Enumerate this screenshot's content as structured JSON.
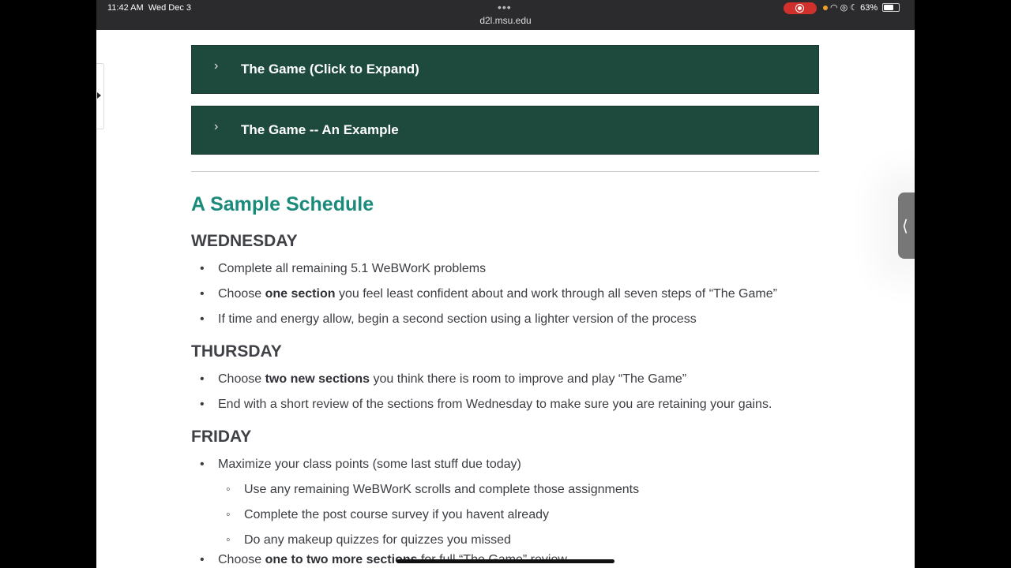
{
  "status": {
    "time": "11:42 AM",
    "date": "Wed Dec 3",
    "url": "d2l.msu.edu",
    "battery": "63%"
  },
  "accordions": [
    {
      "label": "The Game (Click to Expand)"
    },
    {
      "label": "The Game -- An Example"
    }
  ],
  "schedule": {
    "title": "A Sample Schedule",
    "wednesday": {
      "heading": "WEDNESDAY",
      "items": [
        {
          "text": "Complete all remaining 5.1 WeBWorK problems"
        },
        {
          "pre": "Choose ",
          "bold": "one section",
          "post": " you feel least confident about and work through all seven steps of “The Game”"
        },
        {
          "text": "If time and energy allow, begin a second section using a lighter version of the process"
        }
      ]
    },
    "thursday": {
      "heading": "THURSDAY",
      "items": [
        {
          "pre": "Choose ",
          "bold": "two new sections",
          "post": " you think there is room to improve and play “The Game”"
        },
        {
          "text": "End with a short review of the sections from Wednesday to make sure you are retaining your gains."
        }
      ]
    },
    "friday": {
      "heading": "FRIDAY",
      "items": [
        {
          "text": "Maximize your class points (some last stuff due today)"
        },
        {
          "text": "Use any remaining WeBWorK scrolls and complete those assignments"
        },
        {
          "text": "Complete the post course survey if you havent already"
        },
        {
          "text": "Do any makeup quizzes for quizzes you missed"
        },
        {
          "pre": "Choose ",
          "bold": "one to two more sections",
          "post": " for full “The Game” review"
        }
      ]
    }
  },
  "colors": {
    "accordion_bg": "#1e4a3d",
    "heading_teal": "#1a8a7a",
    "recording": "#d0312d"
  }
}
